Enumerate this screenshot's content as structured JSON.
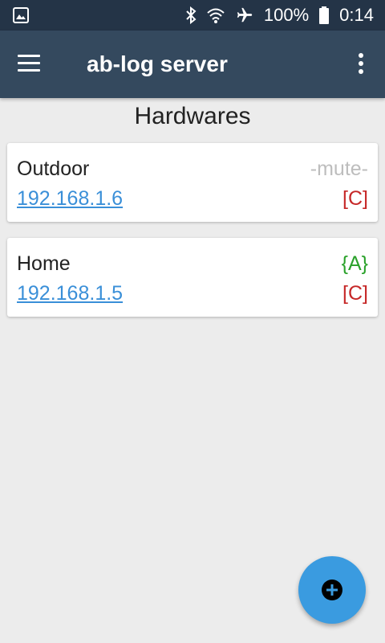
{
  "status_bar": {
    "battery_percent": "100%",
    "time": "0:14",
    "icons": [
      "gallery-icon",
      "bluetooth-icon",
      "wifi-icon",
      "airplane-icon",
      "battery-icon"
    ]
  },
  "app_bar": {
    "title": "ab-log server",
    "menu_icon": "hamburger-menu-icon",
    "overflow_icon": "more-vert-icon"
  },
  "page": {
    "title": "Hardwares"
  },
  "hardwares": [
    {
      "name": "Outdoor",
      "ip": "192.168.1.6",
      "flag": "-mute-",
      "status": "[C]"
    },
    {
      "name": "Home",
      "ip": "192.168.1.5",
      "flag": "{A}",
      "status": "[C]"
    }
  ],
  "fab": {
    "icon": "add-circle-icon"
  },
  "colors": {
    "status_bar": "#243447",
    "app_bar": "#34495e",
    "link": "#3a8fd8",
    "mute": "#bdbdbd",
    "auto": "#2aa12a",
    "status": "#c62828",
    "fab": "#3a9be0"
  }
}
